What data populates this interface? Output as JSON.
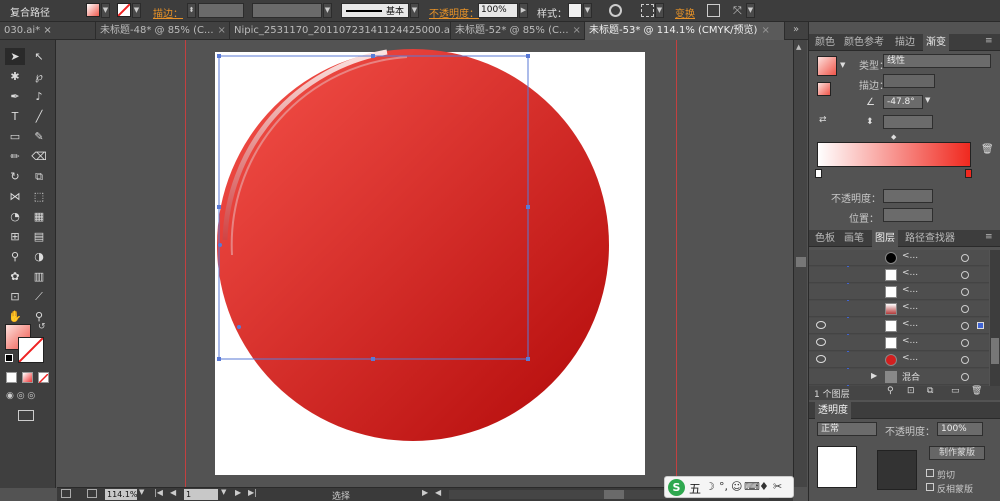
{
  "control_bar": {
    "path_type": "复合路径",
    "stroke_label": "描边：",
    "stroke_style": "基本",
    "opacity_label": "不透明度：",
    "opacity_value": "100%",
    "style_label": "样式：",
    "transform_label": "变换"
  },
  "tabs": [
    {
      "label": "030.ai* ×"
    },
    {
      "label": "未标题-48* @ 85% (C..."
    },
    {
      "label": "Nipic_2531170_20110723141124425000.ai*"
    },
    {
      "label": "未标题-52* @ 85% (C..."
    },
    {
      "label": "未标题-53* @ 114.1% (CMYK/预览)"
    }
  ],
  "status_bar": {
    "zoom": "114.1%",
    "page": "1",
    "tool": "选择"
  },
  "panel": {
    "top_tabs": [
      "颜色",
      "颜色参考",
      "描边",
      "渐变"
    ],
    "gradient": {
      "type_label": "类型：",
      "type_value": "线性",
      "stroke_label": "描边：",
      "angle_value": "-47.8°",
      "opacity_label": "不透明度：",
      "position_label": "位置："
    },
    "layer_tabs": [
      "色板",
      "画笔",
      "图层",
      "路径查找器"
    ],
    "layer_rows": [
      {
        "name": "<...",
        "thumb": "#000000"
      },
      {
        "name": "<...",
        "thumb": "#ffffff"
      },
      {
        "name": "<...",
        "thumb": "#ffffff"
      },
      {
        "name": "<...",
        "thumb": "#b33a3a"
      },
      {
        "name": "<...",
        "thumb": "#ffffff"
      },
      {
        "name": "<...",
        "thumb": "#ffffff"
      },
      {
        "name": "<...",
        "thumb": "#d21f1f"
      },
      {
        "name": "混合",
        "thumb": "#888888"
      }
    ],
    "layer_count": "1 个图层",
    "transparency_tab": "透明度",
    "blend_mode": "正常",
    "opacity_value": "100%",
    "make_mask": "制作蒙版",
    "clip_label": "剪切",
    "invert_mask_label": "反相蒙版"
  },
  "colors": {
    "circle_light": "#f25a4e",
    "circle_dark": "#b20909",
    "accent_orange": "#e89227"
  },
  "ime_bar": {
    "label": "五"
  }
}
